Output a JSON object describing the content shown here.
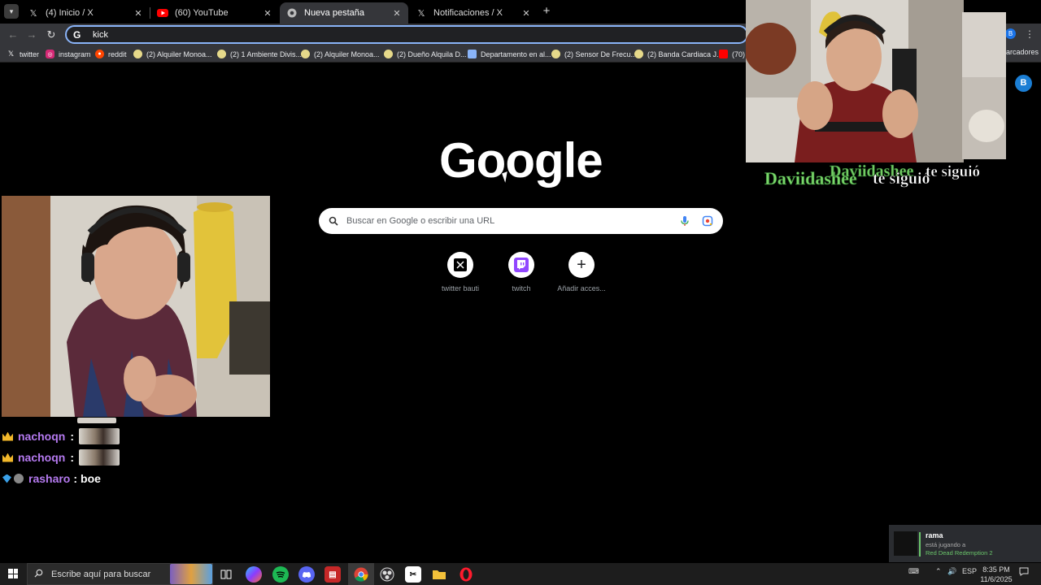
{
  "browser": {
    "tabs": [
      {
        "title": "(4) Inicio / X",
        "icon": "x-logo-icon",
        "active": false
      },
      {
        "title": "(60) YouTube",
        "icon": "youtube-icon",
        "active": false
      },
      {
        "title": "Nueva pestaña",
        "icon": "chrome-icon",
        "active": true
      },
      {
        "title": "Notificaciones / X",
        "icon": "x-logo-icon",
        "active": false
      }
    ],
    "omnibox_text": "kick",
    "profile_letter": "B",
    "bookmarks": [
      {
        "label": "twitter",
        "icon": "x-logo-icon"
      },
      {
        "label": "instagram",
        "icon": "instagram-icon"
      },
      {
        "label": "reddit",
        "icon": "reddit-icon"
      },
      {
        "label": "(2) Alquiler Monoa...",
        "icon": "bookmark-site-icon"
      },
      {
        "label": "(2) 1 Ambiente Divis...",
        "icon": "bookmark-site-icon"
      },
      {
        "label": "(2) Alquiler Monoa...",
        "icon": "bookmark-site-icon"
      },
      {
        "label": "(2) Dueño Alquila D...",
        "icon": "bookmark-site-icon"
      },
      {
        "label": "Departamento en al...",
        "icon": "image-icon"
      },
      {
        "label": "(2) Sensor De Frecu...",
        "icon": "bookmark-site-icon"
      },
      {
        "label": "(2) Banda Cardiaca J...",
        "icon": "bookmark-site-icon"
      },
      {
        "label": "(70) N",
        "icon": "youtube-icon"
      }
    ],
    "bookmarks_overflow": "arcadores"
  },
  "newtab": {
    "logo": "Google",
    "search_placeholder": "Buscar en Google o escribir una URL",
    "shortcuts": [
      {
        "label": "twitter bauti",
        "icon": "x-logo-icon"
      },
      {
        "label": "twitch",
        "icon": "twitch-icon"
      },
      {
        "label": "Añadir acces...",
        "icon": "plus-icon"
      }
    ]
  },
  "stream_overlay": {
    "follow_alert": {
      "name_a": "Daviidashee",
      "verb_a": "te siguió",
      "name_b": "Daviidashee",
      "verb_b": "te siguió"
    },
    "chat": [
      {
        "user": "nachoqn",
        "badge": "crown",
        "message": "",
        "emote": true
      },
      {
        "user": "nachoqn",
        "badge": "crown",
        "message": "",
        "emote": true
      },
      {
        "user": "rasharo",
        "badge": "gem",
        "message": "boe",
        "emote": false
      }
    ],
    "side_badge": "B"
  },
  "taskbar": {
    "search_placeholder": "Escribe aquí para buscar",
    "language": "ESP",
    "time": "8:35 PM",
    "date": "11/6/2025"
  },
  "toast": {
    "name": "rama",
    "status": "está jugando a",
    "game": "Red Dead Redemption 2"
  }
}
